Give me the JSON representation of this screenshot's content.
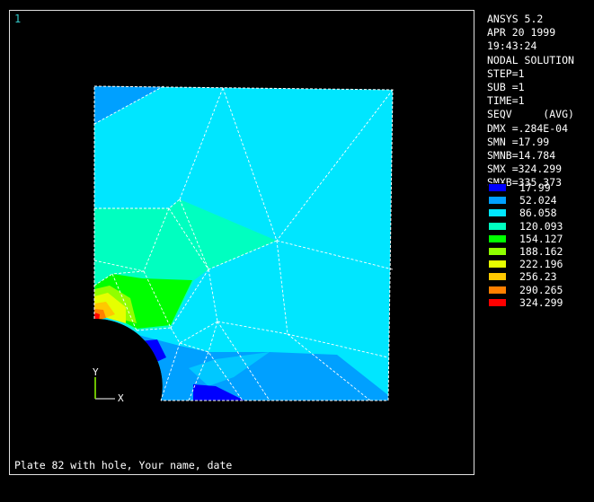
{
  "window": {
    "number": "1",
    "caption": "Plate 82 with hole, Your name, date"
  },
  "info": [
    "ANSYS 5.2",
    "APR 20 1999",
    "19:43:24",
    "NODAL SOLUTION",
    "STEP=1",
    "SUB =1",
    "TIME=1",
    "SEQV     (AVG)",
    "DMX =.284E-04",
    "SMN =17.99",
    "SMNB=14.784",
    "SMX =324.299",
    "SMXB=335.373"
  ],
  "legend": [
    {
      "value": "17.99",
      "color": "#0000ff"
    },
    {
      "value": "52.024",
      "color": "#00a0ff"
    },
    {
      "value": "86.058",
      "color": "#00e6ff"
    },
    {
      "value": "120.093",
      "color": "#00ffc0"
    },
    {
      "value": "154.127",
      "color": "#00ff00"
    },
    {
      "value": "188.162",
      "color": "#90ff00"
    },
    {
      "value": "222.196",
      "color": "#e6ff00"
    },
    {
      "value": "256.23",
      "color": "#ffc800"
    },
    {
      "value": "290.265",
      "color": "#ff8000"
    },
    {
      "value": "324.299",
      "color": "#ff0000"
    }
  ],
  "axes": {
    "x": "X",
    "y": "Y"
  }
}
